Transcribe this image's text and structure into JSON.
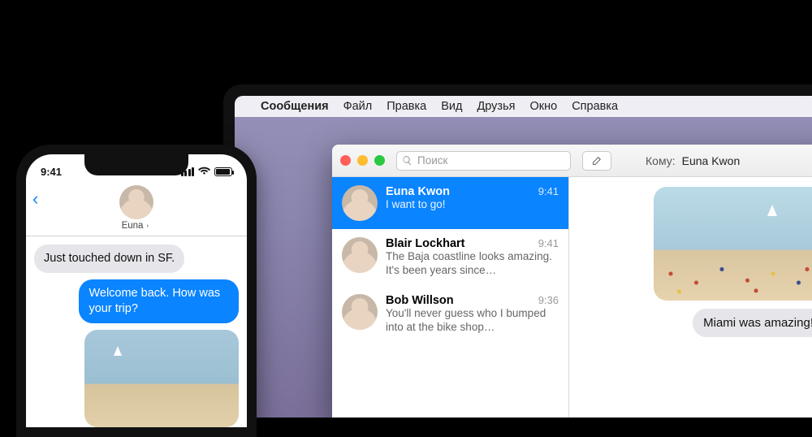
{
  "mac": {
    "menubar": {
      "app": "Сообщения",
      "items": [
        "Файл",
        "Правка",
        "Вид",
        "Друзья",
        "Окно",
        "Справка"
      ]
    },
    "window": {
      "search_placeholder": "Поиск",
      "to_label": "Кому:",
      "to_value": "Euna Kwon"
    },
    "conversations": [
      {
        "name": "Euna Kwon",
        "time": "9:41",
        "preview": "I want to go!",
        "selected": true
      },
      {
        "name": "Blair Lockhart",
        "time": "9:41",
        "preview": "The Baja coastline looks amazing. It's been years since…",
        "selected": false
      },
      {
        "name": "Bob Willson",
        "time": "9:36",
        "preview": "You'll never guess who I bumped into at the bike shop…",
        "selected": false
      }
    ],
    "chat": {
      "outgoing_text": "Miami was amazing!"
    }
  },
  "iphone": {
    "status_time": "9:41",
    "contact_name": "Euna",
    "messages": {
      "incoming_1": "Just touched down in SF.",
      "outgoing_1": "Welcome back. How was your trip?"
    }
  }
}
